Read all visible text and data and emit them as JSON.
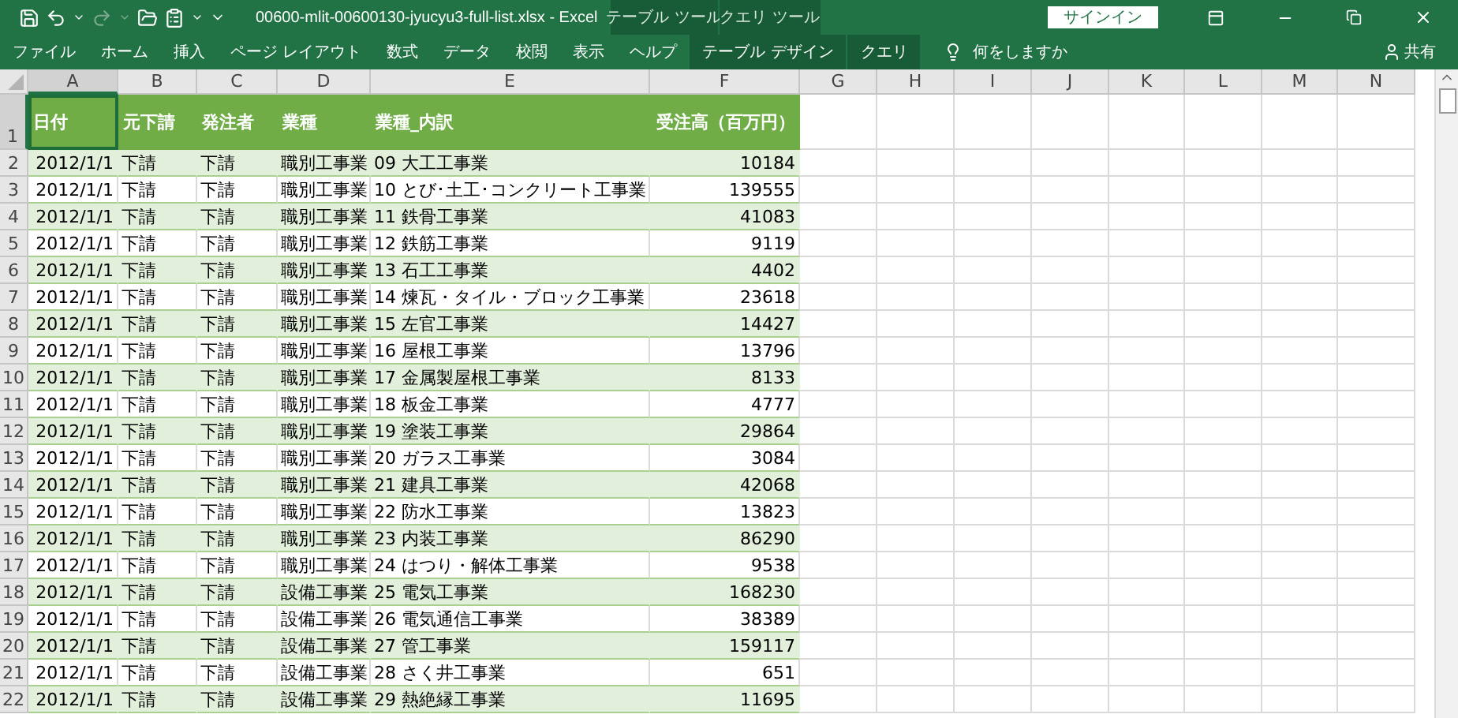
{
  "window": {
    "title": "00600-mlit-00600130-jyucyu3-full-list.xlsx  -  Excel",
    "contextual_groups": [
      {
        "label": "テーブル ツール"
      },
      {
        "label": "クエリ ツール"
      }
    ],
    "sign_in": "サインイン"
  },
  "ribbon_tabs": [
    {
      "label": "ファイル",
      "contextual": false
    },
    {
      "label": "ホーム",
      "contextual": false
    },
    {
      "label": "挿入",
      "contextual": false
    },
    {
      "label": "ページ レイアウト",
      "contextual": false
    },
    {
      "label": "数式",
      "contextual": false
    },
    {
      "label": "データ",
      "contextual": false
    },
    {
      "label": "校閲",
      "contextual": false
    },
    {
      "label": "表示",
      "contextual": false
    },
    {
      "label": "ヘルプ",
      "contextual": false
    },
    {
      "label": "テーブル デザイン",
      "contextual": true
    },
    {
      "label": "クエリ",
      "contextual": true
    }
  ],
  "tell_me": "何をしますか",
  "share": "共有",
  "sheet": {
    "columns": [
      {
        "label": "A",
        "selected": true
      },
      {
        "label": "B",
        "selected": false
      },
      {
        "label": "C",
        "selected": false
      },
      {
        "label": "D",
        "selected": false
      },
      {
        "label": "E",
        "selected": false
      },
      {
        "label": "F",
        "selected": false
      },
      {
        "label": "G",
        "selected": false
      },
      {
        "label": "H",
        "selected": false
      },
      {
        "label": "I",
        "selected": false
      },
      {
        "label": "J",
        "selected": false
      },
      {
        "label": "K",
        "selected": false
      },
      {
        "label": "L",
        "selected": false
      },
      {
        "label": "M",
        "selected": false
      },
      {
        "label": "N",
        "selected": false
      }
    ],
    "header_row": {
      "number": "1",
      "selected": true,
      "cells": [
        "日付",
        "元下請",
        "発注者",
        "業種",
        "業種_内訳",
        "受注高（百万円）"
      ]
    },
    "rows": [
      {
        "number": "2",
        "cells": [
          "2012/1/1",
          "下請",
          "下請",
          "職別工事業",
          "09 大工工事業",
          "10184"
        ]
      },
      {
        "number": "3",
        "cells": [
          "2012/1/1",
          "下請",
          "下請",
          "職別工事業",
          "10 とび･土工･コンクリート工事業",
          "139555"
        ]
      },
      {
        "number": "4",
        "cells": [
          "2012/1/1",
          "下請",
          "下請",
          "職別工事業",
          "11 鉄骨工事業",
          "41083"
        ]
      },
      {
        "number": "5",
        "cells": [
          "2012/1/1",
          "下請",
          "下請",
          "職別工事業",
          "12 鉄筋工事業",
          "9119"
        ]
      },
      {
        "number": "6",
        "cells": [
          "2012/1/1",
          "下請",
          "下請",
          "職別工事業",
          "13 石工工事業",
          "4402"
        ]
      },
      {
        "number": "7",
        "cells": [
          "2012/1/1",
          "下請",
          "下請",
          "職別工事業",
          "14 煉瓦・タイル・ブロック工事業",
          "23618"
        ]
      },
      {
        "number": "8",
        "cells": [
          "2012/1/1",
          "下請",
          "下請",
          "職別工事業",
          "15 左官工事業",
          "14427"
        ]
      },
      {
        "number": "9",
        "cells": [
          "2012/1/1",
          "下請",
          "下請",
          "職別工事業",
          "16 屋根工事業",
          "13796"
        ]
      },
      {
        "number": "10",
        "cells": [
          "2012/1/1",
          "下請",
          "下請",
          "職別工事業",
          "17 金属製屋根工事業",
          "8133"
        ]
      },
      {
        "number": "11",
        "cells": [
          "2012/1/1",
          "下請",
          "下請",
          "職別工事業",
          "18 板金工事業",
          "4777"
        ]
      },
      {
        "number": "12",
        "cells": [
          "2012/1/1",
          "下請",
          "下請",
          "職別工事業",
          "19 塗装工事業",
          "29864"
        ]
      },
      {
        "number": "13",
        "cells": [
          "2012/1/1",
          "下請",
          "下請",
          "職別工事業",
          "20 ガラス工事業",
          "3084"
        ]
      },
      {
        "number": "14",
        "cells": [
          "2012/1/1",
          "下請",
          "下請",
          "職別工事業",
          "21 建具工事業",
          "42068"
        ]
      },
      {
        "number": "15",
        "cells": [
          "2012/1/1",
          "下請",
          "下請",
          "職別工事業",
          "22 防水工事業",
          "13823"
        ]
      },
      {
        "number": "16",
        "cells": [
          "2012/1/1",
          "下請",
          "下請",
          "職別工事業",
          "23 内装工事業",
          "86290"
        ]
      },
      {
        "number": "17",
        "cells": [
          "2012/1/1",
          "下請",
          "下請",
          "職別工事業",
          "24 はつり・解体工事業",
          "9538"
        ]
      },
      {
        "number": "18",
        "cells": [
          "2012/1/1",
          "下請",
          "下請",
          "設備工事業",
          "25 電気工事業",
          "168230"
        ]
      },
      {
        "number": "19",
        "cells": [
          "2012/1/1",
          "下請",
          "下請",
          "設備工事業",
          "26 電気通信工事業",
          "38389"
        ]
      },
      {
        "number": "20",
        "cells": [
          "2012/1/1",
          "下請",
          "下請",
          "設備工事業",
          "27 管工事業",
          "159117"
        ]
      },
      {
        "number": "21",
        "cells": [
          "2012/1/1",
          "下請",
          "下請",
          "設備工事業",
          "28 さく井工事業",
          "651"
        ]
      },
      {
        "number": "22",
        "cells": [
          "2012/1/1",
          "下請",
          "下請",
          "設備工事業",
          "29 熱絶縁工事業",
          "11695"
        ]
      }
    ]
  }
}
